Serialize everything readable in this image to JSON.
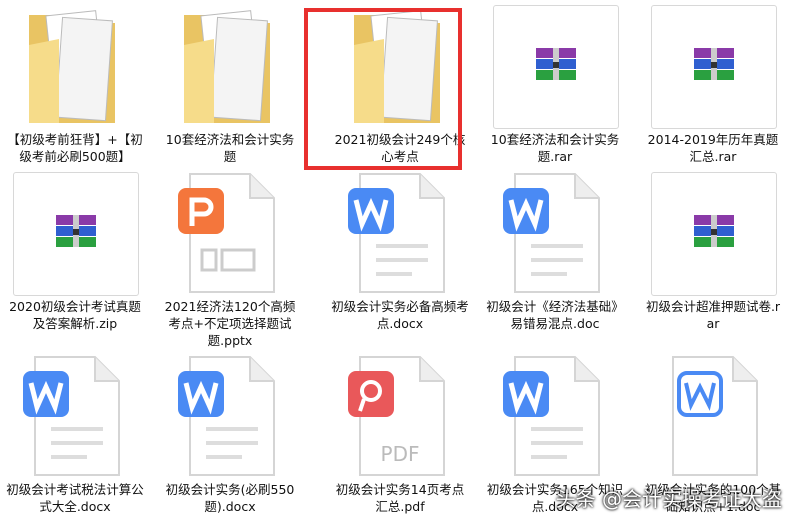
{
  "files": [
    {
      "name": "【初级考前狂背】+【初级考前必刷500题】",
      "type": "folder"
    },
    {
      "name": "10套经济法和会计实务题",
      "type": "folder"
    },
    {
      "name": "2021初级会计249个核心考点",
      "type": "folder",
      "selected": true
    },
    {
      "name": "10套经济法和会计实务题.rar",
      "type": "rar"
    },
    {
      "name": "2014-2019年历年真题汇总.rar",
      "type": "rar"
    },
    {
      "name": "2020初级会计考试真题及答案解析.zip",
      "type": "rar"
    },
    {
      "name": "2021经济法120个高频考点+不定项选择题试题.pptx",
      "type": "pptx"
    },
    {
      "name": "初级会计实务必备高频考点.docx",
      "type": "docx"
    },
    {
      "name": "初级会计《经济法基础》易错易混点.doc",
      "type": "docx"
    },
    {
      "name": "初级会计超准押题试卷.rar",
      "type": "rar"
    },
    {
      "name": "初级会计考试税法计算公式大全.docx",
      "type": "docx"
    },
    {
      "name": "初级会计实务(必刷550题).docx",
      "type": "docx"
    },
    {
      "name": "初级会计实务14页考点汇总.pdf",
      "type": "pdf"
    },
    {
      "name": "初级会计实务165个知识点.docx",
      "type": "docx"
    },
    {
      "name": "初级会计实务的100个基础知识点+1.doc",
      "type": "doc-outline"
    }
  ],
  "pdf_badge": "PDF",
  "watermark": "头条 @会计实操考证大盗",
  "colors": {
    "selection": "#e8302e",
    "word": "#4a8af4",
    "ppt": "#f4763c",
    "pdf": "#e9585a",
    "folder": "#f2d27a"
  }
}
